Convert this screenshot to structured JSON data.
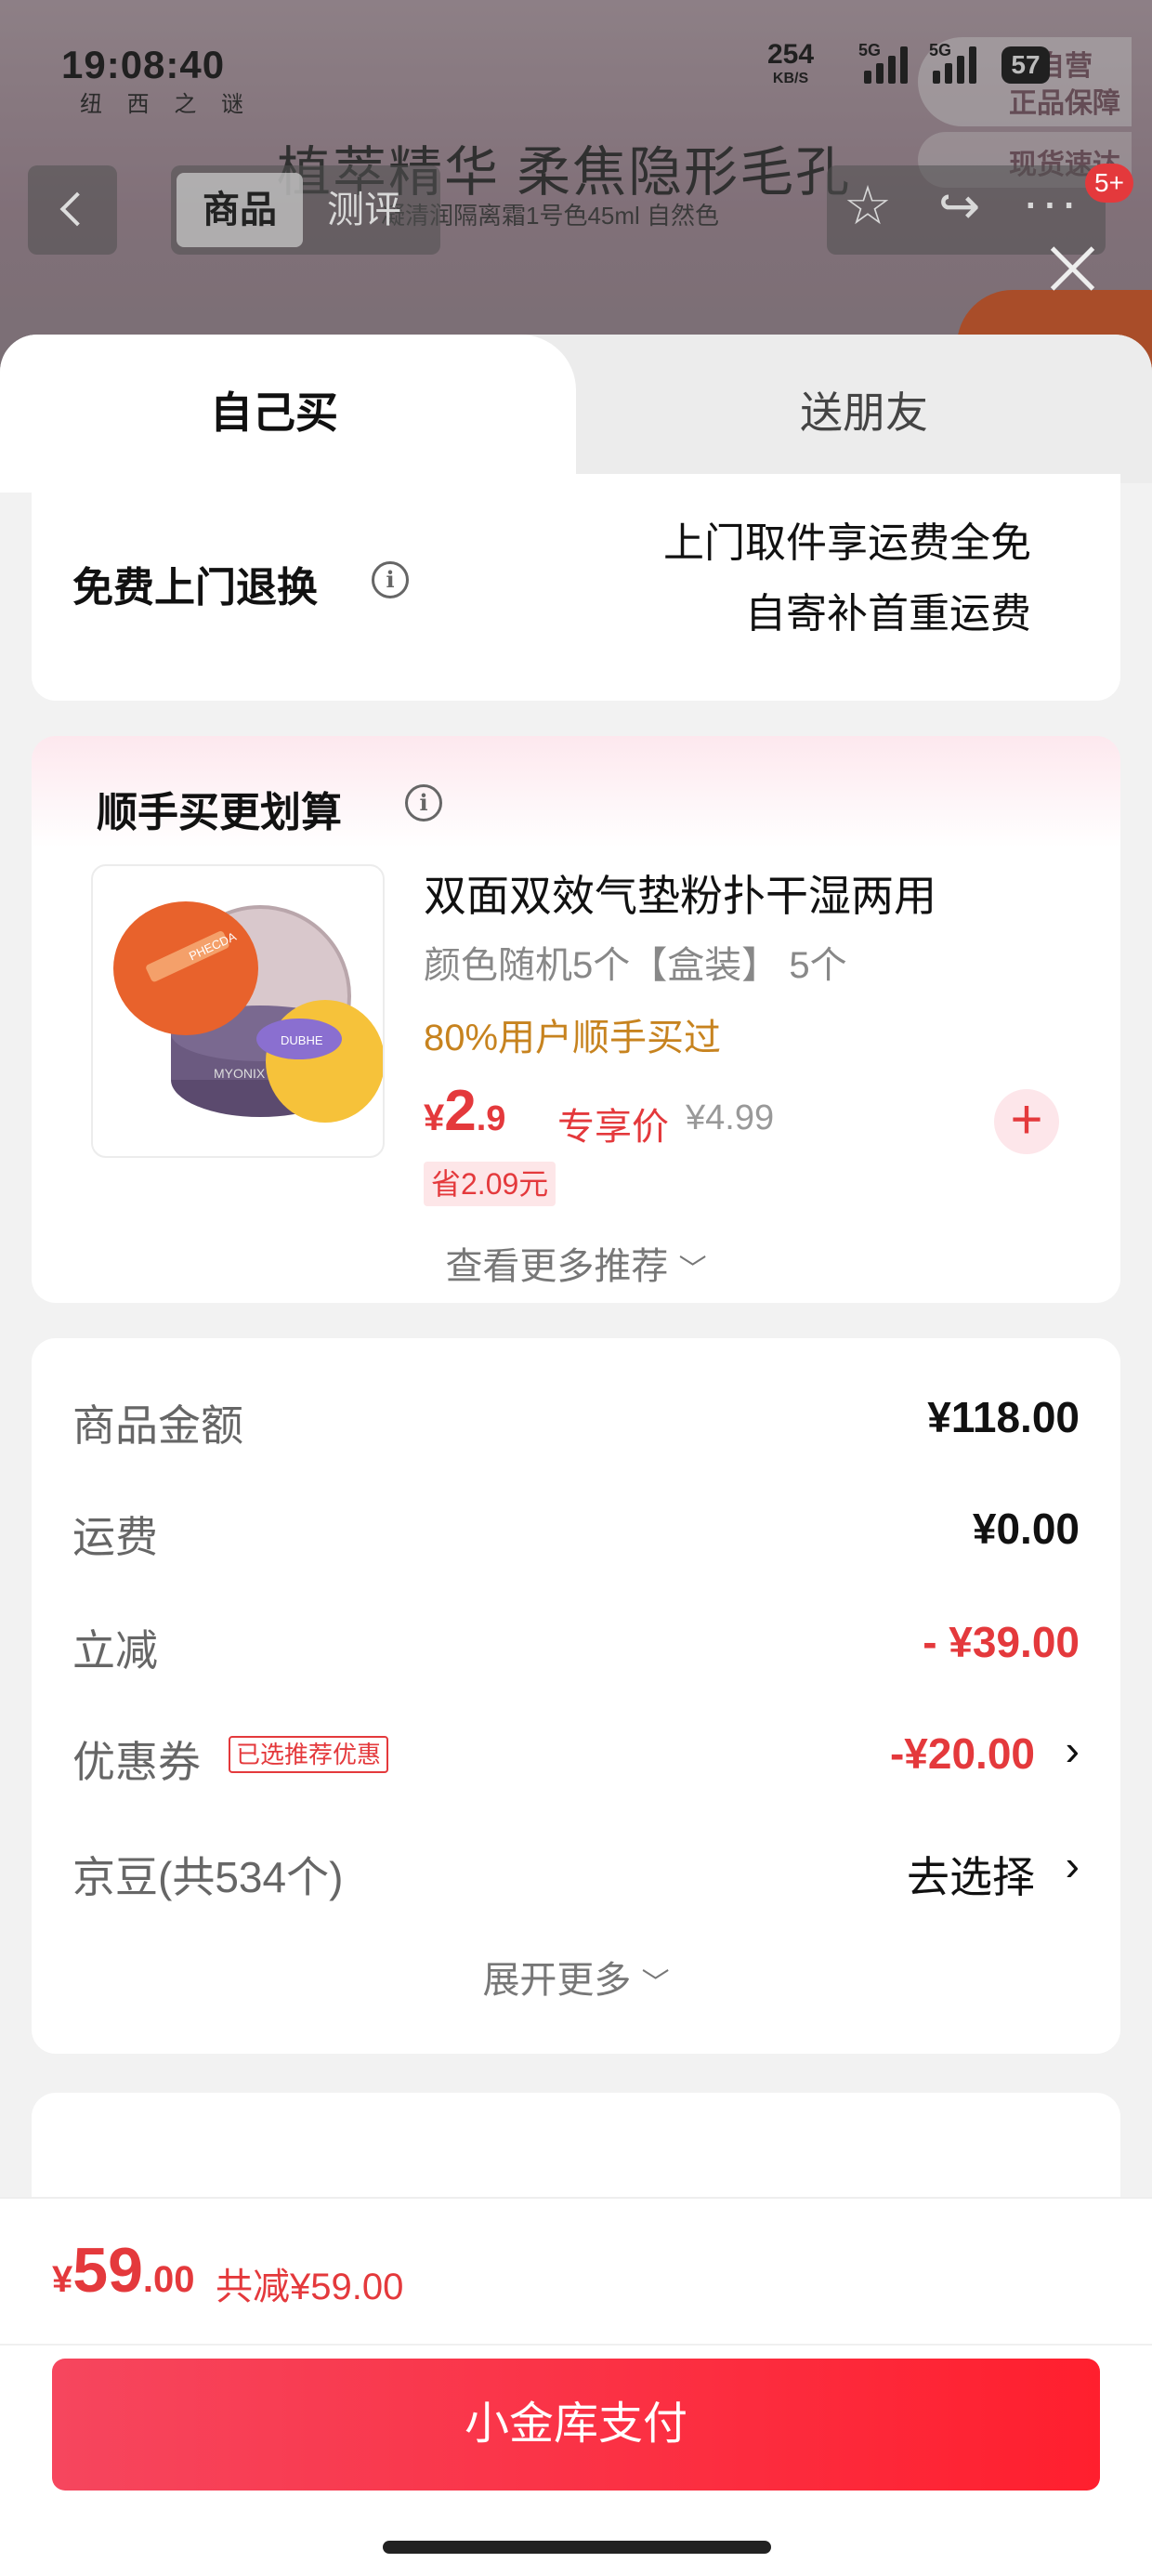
{
  "status_bar": {
    "time": "19:08:40",
    "net_speed_value": "254",
    "net_speed_unit": "KB/S",
    "sig1_label": "5G",
    "sig2_label": "5G",
    "battery": "57"
  },
  "background_page": {
    "brand_sub": "纽 西 之 谜",
    "title": "植萃精华 柔焦隐形毛孔",
    "subtitle": "凝清润隔离霜1号色45ml 自然色",
    "badge_line1": "方自营",
    "badge_line2": "正品保障",
    "badge2": "现货速达",
    "nav_tab_active": "商品",
    "nav_tab_other": "测评",
    "cart_count": "5+"
  },
  "tabs": {
    "self": "自己买",
    "friend": "送朋友"
  },
  "return_card": {
    "title": "免费上门退换",
    "line1": "上门取件享运费全免",
    "line2": "自寄补首重运费"
  },
  "addon": {
    "section_title": "顺手买更划算",
    "name": "双面双效气垫粉扑干湿两用",
    "spec": "颜色随机5个【盒装】 5个",
    "social_proof": "80%用户顺手买过",
    "price_currency": "¥",
    "price_int": "2",
    "price_dec": ".9",
    "price_label": "专享价",
    "original_price": "¥4.99",
    "save_tag": "省2.09元",
    "see_more": "查看更多推荐",
    "thumb_text1": "PHECDA",
    "thumb_text2": "MYONIX",
    "thumb_text3": "DUBHE"
  },
  "costs": {
    "rows": [
      {
        "label": "商品金额",
        "value": "¥118.00"
      },
      {
        "label": "运费",
        "value": "¥0.00"
      },
      {
        "label": "立减",
        "value": "- ¥39.00"
      },
      {
        "label": "优惠券",
        "tag": "已选推荐优惠",
        "value": "-¥20.00"
      },
      {
        "label": "京豆(共534个)",
        "value": "去选择"
      }
    ],
    "expand_more": "展开更多"
  },
  "footer": {
    "total_currency": "¥",
    "total_int": "59",
    "total_dec": ".00",
    "saved": "共减¥59.00",
    "pay_button": "小金库支付"
  },
  "icons": {
    "info": "info-icon",
    "chevron_down": "chevron-down-icon",
    "chevron_right": "chevron-right-icon",
    "plus": "plus-icon",
    "close": "close-icon",
    "back": "back-arrow-icon",
    "star": "star-icon",
    "share": "share-icon",
    "more": "more-icon"
  },
  "colors": {
    "accent_red": "#e4393c",
    "social_orange": "#c7831f",
    "pay_gradient_start": "#f6465e",
    "pay_gradient_end": "#ff1f2e"
  }
}
